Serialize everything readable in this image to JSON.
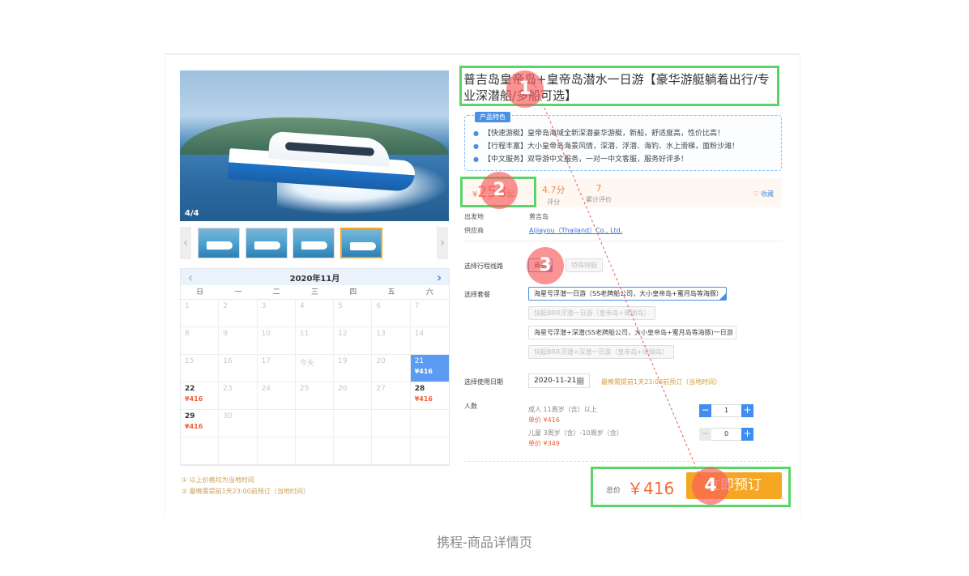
{
  "caption": "携程-商品详情页",
  "gallery": {
    "counter": "4/4",
    "prev_arrow": "‹",
    "next_arrow": "›"
  },
  "calendar": {
    "month": "2020年11月",
    "weekdays": [
      "日",
      "一",
      "二",
      "三",
      "四",
      "五",
      "六"
    ],
    "weeks": [
      [
        {
          "d": "1"
        },
        {
          "d": "2"
        },
        {
          "d": "3"
        },
        {
          "d": "4"
        },
        {
          "d": "5"
        },
        {
          "d": "6"
        },
        {
          "d": "7"
        }
      ],
      [
        {
          "d": "8"
        },
        {
          "d": "9"
        },
        {
          "d": "10"
        },
        {
          "d": "11"
        },
        {
          "d": "12"
        },
        {
          "d": "13"
        },
        {
          "d": "14"
        }
      ],
      [
        {
          "d": "15"
        },
        {
          "d": "16"
        },
        {
          "d": "17"
        },
        {
          "d": "今天"
        },
        {
          "d": "19"
        },
        {
          "d": "20"
        },
        {
          "d": "21",
          "p": "¥416",
          "state": "selected"
        }
      ],
      [
        {
          "d": "22",
          "p": "¥416",
          "state": "avail"
        },
        {
          "d": "23"
        },
        {
          "d": "24"
        },
        {
          "d": "25"
        },
        {
          "d": "26"
        },
        {
          "d": "27"
        },
        {
          "d": "28",
          "p": "¥416",
          "state": "avail"
        }
      ],
      [
        {
          "d": "29",
          "p": "¥416",
          "state": "avail"
        },
        {
          "d": "30"
        },
        {
          "d": ""
        },
        {
          "d": ""
        },
        {
          "d": ""
        },
        {
          "d": ""
        },
        {
          "d": ""
        }
      ],
      [
        {
          "d": ""
        },
        {
          "d": ""
        },
        {
          "d": ""
        },
        {
          "d": ""
        },
        {
          "d": ""
        },
        {
          "d": ""
        },
        {
          "d": ""
        }
      ]
    ],
    "notes": [
      "① 以上价格均为当地时间",
      "② 最晚需提前1天23:00前预订（当地时间）"
    ]
  },
  "product": {
    "title": "普吉岛皇帝岛+皇帝岛潜水一日游【豪华游艇躺着出行/专业深潜船/多船可选】",
    "features_tag": "产品特色",
    "features": [
      "【快速游艇】皇帝岛海域全新深潜豪华游艇，新船，舒适度高，性价比高！",
      "【行程丰富】大小皇帝岛海景风情，深潜、浮潜、海钓、水上滑梯，面粉沙滩！",
      "【中文服务】双导游中文服务，一对一中文客服，服务好评多！"
    ],
    "price_prefix": "¥",
    "price": "258",
    "price_suffix": "起",
    "score_value": "4.7分",
    "score_label": "评分",
    "reviews_value": "7",
    "reviews_label": "累计评价",
    "fav_icon": "♡",
    "fav_label": "收藏",
    "departure_label": "出发地",
    "departure_value": "普吉岛",
    "supplier_label": "供应商",
    "supplier_value": "Aijiayou（Thailand）Co., Ltd."
  },
  "booking": {
    "route_label": "选择行程线路",
    "routes": [
      "商品",
      "特殊快艇"
    ],
    "package_label": "选择套餐",
    "packages": [
      "海星号浮潜一日游（SS老牌船公司，大小皇帝岛+蜜月岛等海豚）",
      "快艇BRR浮潜一日游（皇帝岛+珊瑚岛）",
      "海星号浮潜+深潜(SS老牌船公司，大小皇帝岛+蜜月岛等海豚)一日游",
      "快艇BRR浮潜+深潜一日游（皇帝岛+珊瑚岛）"
    ],
    "date_label": "选择使用日期",
    "date_value": "2020-11-21",
    "calendar_icon": "▦",
    "date_tip": "最晚需提前1天23:00前预订（当地时间）",
    "pax_label": "人数",
    "adult_label": "成人  11周岁（含）以上",
    "adult_price": "单价 ¥416",
    "adult_qty": "1",
    "child_label": "儿童  3周岁（含）-10周岁（含）",
    "child_price": "单价 ¥349",
    "child_qty": "0",
    "minus": "−",
    "plus": "+",
    "total_label": "总价",
    "total_value": "￥416",
    "book_label": "立即预订"
  },
  "annotations": {
    "badges": [
      "1",
      "2",
      "3",
      "4"
    ],
    "box_color": "#5bd46a",
    "badge_color": "#f75a5a"
  },
  "colors": {
    "accent": "#4a90e2",
    "price": "#f26b3a",
    "book_button": "#f5a623",
    "selected_date": "#5b9bf2"
  }
}
